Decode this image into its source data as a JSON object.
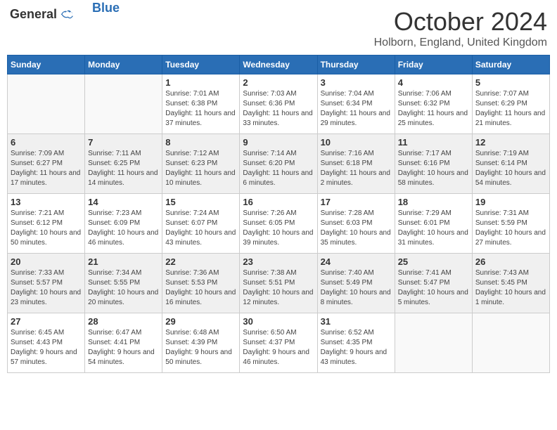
{
  "logo": {
    "text_general": "General",
    "text_blue": "Blue"
  },
  "title": "October 2024",
  "location": "Holborn, England, United Kingdom",
  "days_of_week": [
    "Sunday",
    "Monday",
    "Tuesday",
    "Wednesday",
    "Thursday",
    "Friday",
    "Saturday"
  ],
  "weeks": [
    [
      {
        "day": "",
        "sunrise": "",
        "sunset": "",
        "daylight": ""
      },
      {
        "day": "",
        "sunrise": "",
        "sunset": "",
        "daylight": ""
      },
      {
        "day": "1",
        "sunrise": "Sunrise: 7:01 AM",
        "sunset": "Sunset: 6:38 PM",
        "daylight": "Daylight: 11 hours and 37 minutes."
      },
      {
        "day": "2",
        "sunrise": "Sunrise: 7:03 AM",
        "sunset": "Sunset: 6:36 PM",
        "daylight": "Daylight: 11 hours and 33 minutes."
      },
      {
        "day": "3",
        "sunrise": "Sunrise: 7:04 AM",
        "sunset": "Sunset: 6:34 PM",
        "daylight": "Daylight: 11 hours and 29 minutes."
      },
      {
        "day": "4",
        "sunrise": "Sunrise: 7:06 AM",
        "sunset": "Sunset: 6:32 PM",
        "daylight": "Daylight: 11 hours and 25 minutes."
      },
      {
        "day": "5",
        "sunrise": "Sunrise: 7:07 AM",
        "sunset": "Sunset: 6:29 PM",
        "daylight": "Daylight: 11 hours and 21 minutes."
      }
    ],
    [
      {
        "day": "6",
        "sunrise": "Sunrise: 7:09 AM",
        "sunset": "Sunset: 6:27 PM",
        "daylight": "Daylight: 11 hours and 17 minutes."
      },
      {
        "day": "7",
        "sunrise": "Sunrise: 7:11 AM",
        "sunset": "Sunset: 6:25 PM",
        "daylight": "Daylight: 11 hours and 14 minutes."
      },
      {
        "day": "8",
        "sunrise": "Sunrise: 7:12 AM",
        "sunset": "Sunset: 6:23 PM",
        "daylight": "Daylight: 11 hours and 10 minutes."
      },
      {
        "day": "9",
        "sunrise": "Sunrise: 7:14 AM",
        "sunset": "Sunset: 6:20 PM",
        "daylight": "Daylight: 11 hours and 6 minutes."
      },
      {
        "day": "10",
        "sunrise": "Sunrise: 7:16 AM",
        "sunset": "Sunset: 6:18 PM",
        "daylight": "Daylight: 11 hours and 2 minutes."
      },
      {
        "day": "11",
        "sunrise": "Sunrise: 7:17 AM",
        "sunset": "Sunset: 6:16 PM",
        "daylight": "Daylight: 10 hours and 58 minutes."
      },
      {
        "day": "12",
        "sunrise": "Sunrise: 7:19 AM",
        "sunset": "Sunset: 6:14 PM",
        "daylight": "Daylight: 10 hours and 54 minutes."
      }
    ],
    [
      {
        "day": "13",
        "sunrise": "Sunrise: 7:21 AM",
        "sunset": "Sunset: 6:12 PM",
        "daylight": "Daylight: 10 hours and 50 minutes."
      },
      {
        "day": "14",
        "sunrise": "Sunrise: 7:23 AM",
        "sunset": "Sunset: 6:09 PM",
        "daylight": "Daylight: 10 hours and 46 minutes."
      },
      {
        "day": "15",
        "sunrise": "Sunrise: 7:24 AM",
        "sunset": "Sunset: 6:07 PM",
        "daylight": "Daylight: 10 hours and 43 minutes."
      },
      {
        "day": "16",
        "sunrise": "Sunrise: 7:26 AM",
        "sunset": "Sunset: 6:05 PM",
        "daylight": "Daylight: 10 hours and 39 minutes."
      },
      {
        "day": "17",
        "sunrise": "Sunrise: 7:28 AM",
        "sunset": "Sunset: 6:03 PM",
        "daylight": "Daylight: 10 hours and 35 minutes."
      },
      {
        "day": "18",
        "sunrise": "Sunrise: 7:29 AM",
        "sunset": "Sunset: 6:01 PM",
        "daylight": "Daylight: 10 hours and 31 minutes."
      },
      {
        "day": "19",
        "sunrise": "Sunrise: 7:31 AM",
        "sunset": "Sunset: 5:59 PM",
        "daylight": "Daylight: 10 hours and 27 minutes."
      }
    ],
    [
      {
        "day": "20",
        "sunrise": "Sunrise: 7:33 AM",
        "sunset": "Sunset: 5:57 PM",
        "daylight": "Daylight: 10 hours and 23 minutes."
      },
      {
        "day": "21",
        "sunrise": "Sunrise: 7:34 AM",
        "sunset": "Sunset: 5:55 PM",
        "daylight": "Daylight: 10 hours and 20 minutes."
      },
      {
        "day": "22",
        "sunrise": "Sunrise: 7:36 AM",
        "sunset": "Sunset: 5:53 PM",
        "daylight": "Daylight: 10 hours and 16 minutes."
      },
      {
        "day": "23",
        "sunrise": "Sunrise: 7:38 AM",
        "sunset": "Sunset: 5:51 PM",
        "daylight": "Daylight: 10 hours and 12 minutes."
      },
      {
        "day": "24",
        "sunrise": "Sunrise: 7:40 AM",
        "sunset": "Sunset: 5:49 PM",
        "daylight": "Daylight: 10 hours and 8 minutes."
      },
      {
        "day": "25",
        "sunrise": "Sunrise: 7:41 AM",
        "sunset": "Sunset: 5:47 PM",
        "daylight": "Daylight: 10 hours and 5 minutes."
      },
      {
        "day": "26",
        "sunrise": "Sunrise: 7:43 AM",
        "sunset": "Sunset: 5:45 PM",
        "daylight": "Daylight: 10 hours and 1 minute."
      }
    ],
    [
      {
        "day": "27",
        "sunrise": "Sunrise: 6:45 AM",
        "sunset": "Sunset: 4:43 PM",
        "daylight": "Daylight: 9 hours and 57 minutes."
      },
      {
        "day": "28",
        "sunrise": "Sunrise: 6:47 AM",
        "sunset": "Sunset: 4:41 PM",
        "daylight": "Daylight: 9 hours and 54 minutes."
      },
      {
        "day": "29",
        "sunrise": "Sunrise: 6:48 AM",
        "sunset": "Sunset: 4:39 PM",
        "daylight": "Daylight: 9 hours and 50 minutes."
      },
      {
        "day": "30",
        "sunrise": "Sunrise: 6:50 AM",
        "sunset": "Sunset: 4:37 PM",
        "daylight": "Daylight: 9 hours and 46 minutes."
      },
      {
        "day": "31",
        "sunrise": "Sunrise: 6:52 AM",
        "sunset": "Sunset: 4:35 PM",
        "daylight": "Daylight: 9 hours and 43 minutes."
      },
      {
        "day": "",
        "sunrise": "",
        "sunset": "",
        "daylight": ""
      },
      {
        "day": "",
        "sunrise": "",
        "sunset": "",
        "daylight": ""
      }
    ]
  ]
}
